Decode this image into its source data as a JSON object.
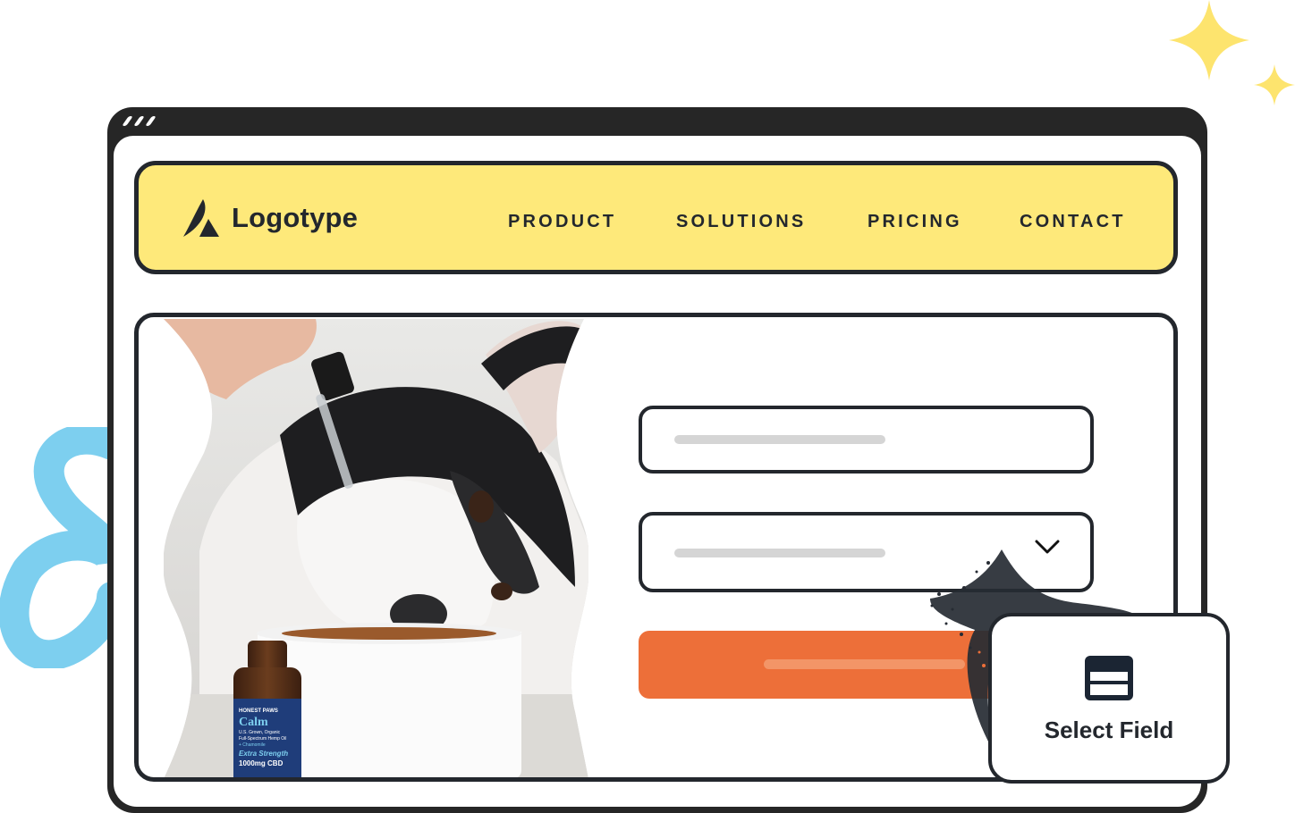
{
  "decorations": {
    "sparkle_color": "#fde46e",
    "squiggle_color": "#7dcfef"
  },
  "window": {
    "frame_color": "#262626",
    "control_dots": 3
  },
  "navbar": {
    "background": "#fee97a",
    "logo": {
      "icon": "logo-mark-icon",
      "text": "Logotype"
    },
    "links": [
      {
        "label": "PRODUCT"
      },
      {
        "label": "SOLUTIONS"
      },
      {
        "label": "PRICING"
      },
      {
        "label": "CONTACT"
      }
    ]
  },
  "hero": {
    "photo": {
      "description": "Husky eating from white bowl while a hand holds a dropper; CBD oil bottle in front",
      "bottle_label": {
        "brand": "HONEST PAWS",
        "product": "Calm",
        "line1": "U.S. Grown, Organic",
        "line2": "Full-Spectrum Hemp Oil",
        "line3": "+ Chamomile",
        "strength": "Extra Strength",
        "dose": "1000mg CBD"
      }
    },
    "form": {
      "text_field": {
        "placeholder": ""
      },
      "select_field": {
        "placeholder": "",
        "icon": "chevron-down-icon"
      },
      "submit_button": {
        "label": "",
        "color": "#ed6f39"
      }
    }
  },
  "tooltip": {
    "icon": "select-field-icon",
    "label": "Select Field"
  }
}
